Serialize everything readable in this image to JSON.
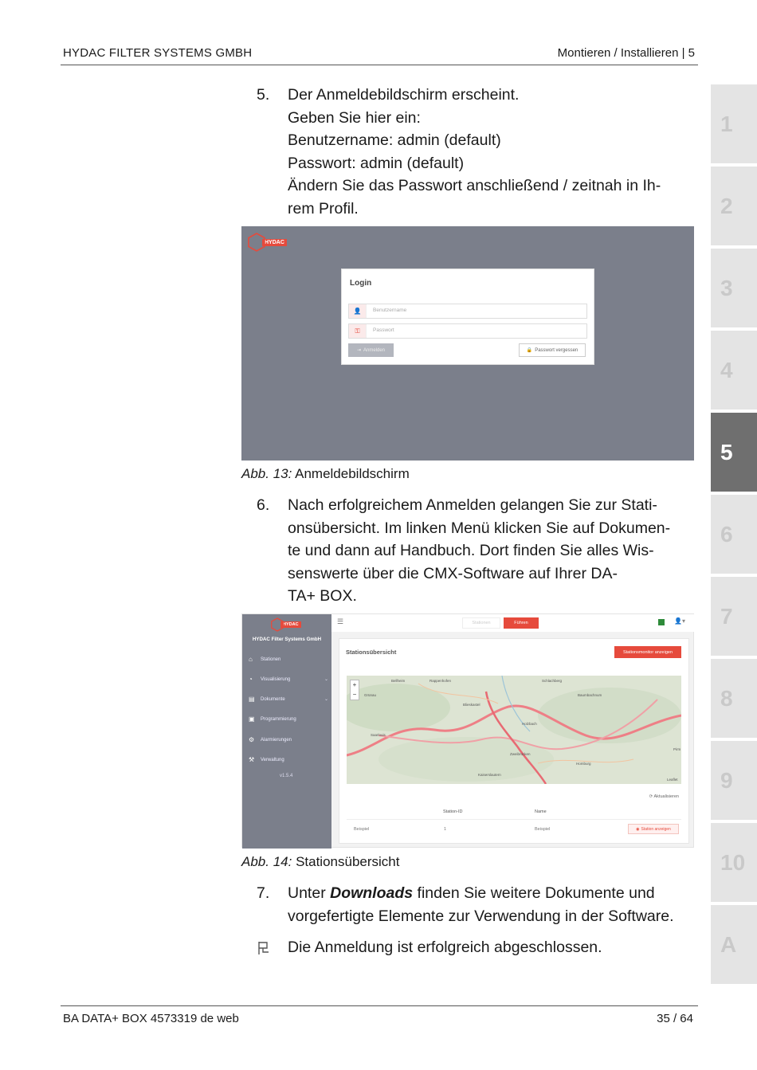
{
  "header": {
    "company": "HYDAC FILTER SYSTEMS GMBH",
    "chapter": "Montieren / Installieren | 5"
  },
  "footer": {
    "document": "BA DATA+ BOX 4573319 de web",
    "page": "35 / 64"
  },
  "tabs": [
    {
      "label": "1",
      "active": false
    },
    {
      "label": "2",
      "active": false
    },
    {
      "label": "3",
      "active": false
    },
    {
      "label": "4",
      "active": false
    },
    {
      "label": "5",
      "active": true
    },
    {
      "label": "6",
      "active": false
    },
    {
      "label": "7",
      "active": false
    },
    {
      "label": "8",
      "active": false
    },
    {
      "label": "9",
      "active": false
    },
    {
      "label": "10",
      "active": false
    },
    {
      "label": "A",
      "active": false
    }
  ],
  "step5": {
    "number": "5.",
    "lines": [
      "Der Anmeldebildschirm erscheint.",
      "Geben Sie hier ein:",
      "Benutzername: admin (default)",
      "Passwort: admin (default)",
      "Ändern Sie das Passwort anschließend / zeitnah in Ih-",
      "rem Profil."
    ]
  },
  "figure13": {
    "label": "Abb. 13:",
    "title": "Anmeldebildschirm",
    "logo_text": "HYDAC",
    "login_title": "Login",
    "username_placeholder": "Benutzername",
    "password_placeholder": "Passwort",
    "login_button": "Anmelden",
    "forgot_button": "Passwort vergessen"
  },
  "step6": {
    "number": "6.",
    "lines": [
      "Nach erfolgreichem Anmelden gelangen Sie zur Stati-",
      "onsübersicht. Im linken Menü klicken Sie auf Dokumen-",
      "te und dann auf Handbuch. Dort finden Sie alles Wis-",
      "senswerte über die CMX-Software auf Ihrer DA-",
      "TA+ BOX."
    ]
  },
  "figure14": {
    "label": "Abb. 14:",
    "title": "Stationsübersicht",
    "logo_text": "HYDAC",
    "company": "HYDAC Filter Systems GmbH",
    "menu": [
      {
        "icon": "⌂",
        "label": "Stationen",
        "chevron": ""
      },
      {
        "icon": "◔",
        "label": "Visualisierung",
        "chevron": "⌄"
      },
      {
        "icon": "▤",
        "label": "Dokumente",
        "chevron": "⌄"
      },
      {
        "icon": "▣",
        "label": "Programmierung",
        "chevron": ""
      },
      {
        "icon": "⚙",
        "label": "Alarmierungen",
        "chevron": ""
      },
      {
        "icon": "⚒",
        "label": "Verwaltung",
        "chevron": ""
      }
    ],
    "version": "v1.5.4",
    "top_pill_1": "Stationen",
    "top_pill_2": "Führen",
    "panel_title": "Stationsübersicht",
    "panel_button": "Stationsmonitor anzeigen",
    "map_labels": [
      "Bellheim",
      "Rappenhofen",
      "Schlachberg",
      "Grünau",
      "Baumbachnum",
      "Holzbach",
      "Blieskastel",
      "Zweibrücken",
      "Homburg",
      "Saarlouis",
      "Kaiserslautern",
      "Leaflet",
      "Pirm"
    ],
    "refresh": "Aktualisieren",
    "col_station_id": "Station-ID",
    "col_name": "Name",
    "row_name_left": "Beispiel",
    "row_id": "1",
    "row_name": "Beispiel",
    "row_action": "Station anzeigen"
  },
  "step7": {
    "number": "7.",
    "prefix": "Unter ",
    "keyword": "Downloads",
    "suffix": " finden Sie weitere Dokumente und",
    "line2": "vorgefertigte Elemente zur Verwendung in der Software."
  },
  "result": {
    "icon": "result-flag-icon",
    "text": "Die Anmeldung ist erfolgreich abgeschlossen."
  },
  "colors": {
    "accent": "#e64a3c",
    "screenshot_gray": "#7b7f8b",
    "tab_active": "#6f6f6f",
    "tab_inactive": "#e4e4e4"
  }
}
